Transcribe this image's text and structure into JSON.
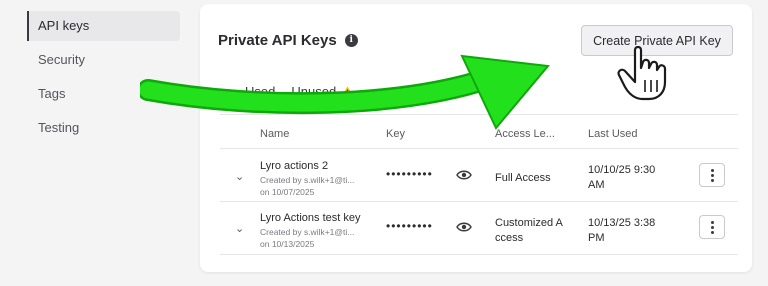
{
  "sidebar": {
    "items": [
      {
        "label": "API keys"
      },
      {
        "label": "Security"
      },
      {
        "label": "Tags"
      },
      {
        "label": "Testing"
      }
    ]
  },
  "card": {
    "title": "Private API Keys",
    "create_button": "Create Private API Key"
  },
  "tabs": [
    {
      "label": "Used"
    },
    {
      "label": "Unused"
    }
  ],
  "table": {
    "columns": [
      "Name",
      "Key",
      "Access Le...",
      "Last Used"
    ],
    "rows": [
      {
        "name": "Lyro actions 2",
        "created_by": "Created by s.wilk+1@ti...",
        "created_on": "on 10/07/2025",
        "key": "•••••••••",
        "access": "Full Access",
        "last_used_1": "10/10/25 9:30",
        "last_used_2": "AM"
      },
      {
        "name": "Lyro Actions test key",
        "created_by": "Created by s.wilk+1@ti...",
        "created_on": "on 10/13/2025",
        "key": "•••••••••",
        "access_1": "Customized A",
        "access_2": "ccess",
        "last_used_1": "10/13/25 3:38",
        "last_used_2": "PM"
      }
    ]
  },
  "colors": {
    "arrow": "#22e11c",
    "warning": "#f2c200",
    "background": "#f4f4f5"
  }
}
